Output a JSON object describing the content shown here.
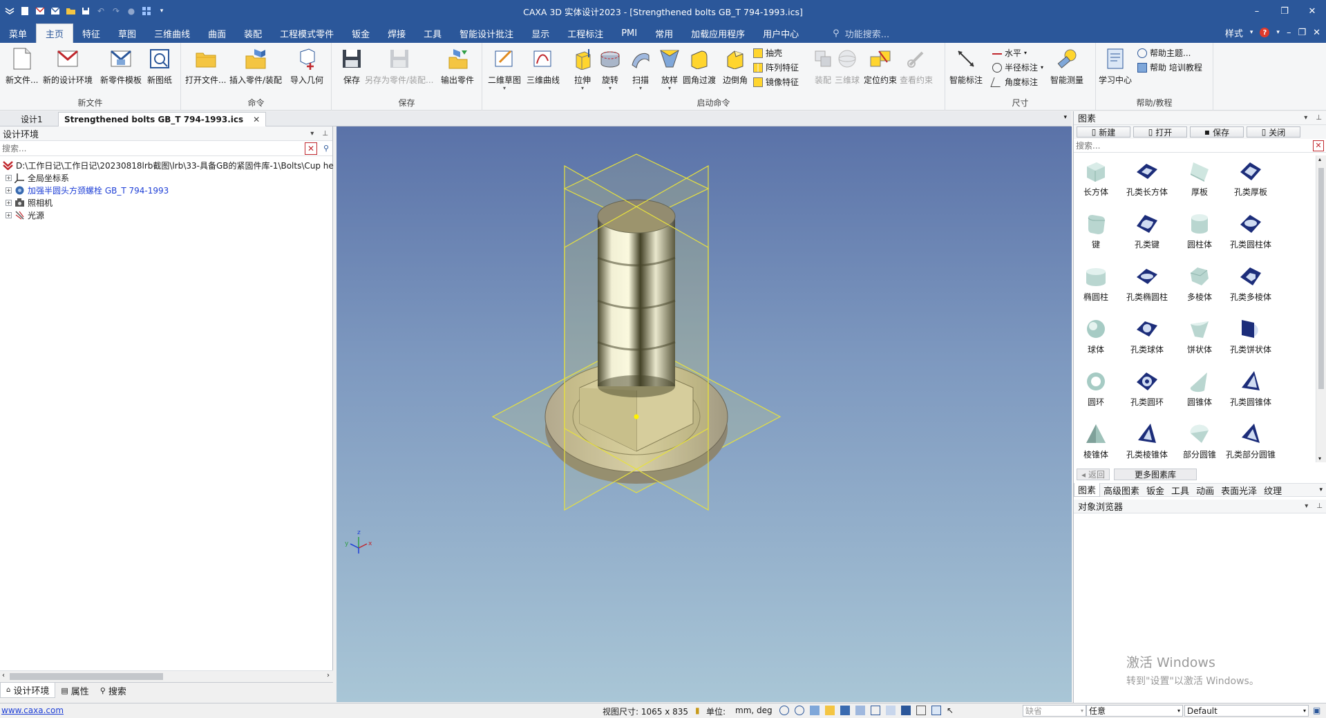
{
  "window": {
    "title": "CAXA 3D 实体设计2023 - [Strengthened bolts GB_T 794-1993.ics]",
    "controls": [
      "–",
      "❐",
      "✕"
    ]
  },
  "menu": {
    "tabs": [
      "菜单",
      "主页",
      "特征",
      "草图",
      "三维曲线",
      "曲面",
      "装配",
      "工程模式零件",
      "钣金",
      "焊接",
      "工具",
      "智能设计批注",
      "显示",
      "工程标注",
      "PMI",
      "常用",
      "加载应用程序",
      "用户中心"
    ],
    "active_index": 1,
    "search_placeholder": "功能搜索...",
    "style_label": "样式",
    "help_icon": "?"
  },
  "ribbon": {
    "groups": {
      "new_file": "新文件",
      "command": "命令",
      "save": "保存",
      "launch": "启动命令",
      "dimension": "尺寸",
      "help": "帮助/教程"
    },
    "buttons": {
      "new_file": "新文件...",
      "new_design_env": "新的设计环境",
      "new_part_template": "新零件模板",
      "new_drawing": "新图纸",
      "open_file": "打开文件...",
      "insert_part": "插入零件/装配",
      "import_geometry": "导入几何",
      "save": "保存",
      "save_as_part": "另存为零件/装配...",
      "export_part": "输出零件",
      "sketch_2d": "二维草图",
      "curve_3d": "三维曲线",
      "extrude": "拉伸",
      "revolve": "旋转",
      "sweep": "扫描",
      "loft": "放样",
      "fillet": "圆角过渡",
      "chamfer": "边倒角",
      "shell": "抽壳",
      "pattern": "阵列特征",
      "mirror": "镜像特征",
      "assembly": "装配",
      "ball_3d": "三维球",
      "position_constraint": "定位约束",
      "view_constraint": "查看约束",
      "smart_dimension": "智能标注",
      "horizontal": "水平",
      "radius_dim": "半径标注",
      "angle_dim": "角度标注",
      "smart_measure": "智能测量",
      "learning_center": "学习中心",
      "help_topics": "帮助主题...",
      "help_training": "帮助 培训教程"
    }
  },
  "doc_tabs": [
    {
      "label": "设计1",
      "active": false
    },
    {
      "label": "Strengthened bolts GB_T 794-1993.ics",
      "active": true
    }
  ],
  "left_panel": {
    "title": "设计环境",
    "search_placeholder": "搜索...",
    "tree": [
      {
        "label": "D:\\工作日记\\工作日记\\20230818lrb截图\\lrb\\33-具备GB的紧固件库-1\\Bolts\\Cup he",
        "icon": "design-env-icon",
        "link": false
      },
      {
        "label": "全局坐标系",
        "icon": "axis-icon",
        "link": false
      },
      {
        "label": "加强半圆头方颈螺栓 GB_T 794-1993",
        "icon": "part-icon",
        "link": true
      },
      {
        "label": "照相机",
        "icon": "camera-icon",
        "link": false
      },
      {
        "label": "光源",
        "icon": "light-icon",
        "link": false
      }
    ],
    "tabs": [
      "设计环境",
      "属性",
      "搜索"
    ]
  },
  "viewport": {
    "axis_labels": {
      "x": "x",
      "y": "y",
      "z": "z"
    }
  },
  "right_panel": {
    "title": "图素",
    "tools": [
      "新建",
      "打开",
      "保存",
      "关闭"
    ],
    "search_placeholder": "搜索...",
    "items": [
      [
        "长方体",
        "孔类长方体",
        "厚板",
        "孔类厚板"
      ],
      [
        "键",
        "孔类键",
        "圆柱体",
        "孔类圆柱体"
      ],
      [
        "椭圆柱",
        "孔类椭圆柱",
        "多棱体",
        "孔类多棱体"
      ],
      [
        "球体",
        "孔类球体",
        "饼状体",
        "孔类饼状体"
      ],
      [
        "圆环",
        "孔类圆环",
        "圆锥体",
        "孔类圆锥体"
      ],
      [
        "棱锥体",
        "孔类棱锥体",
        "部分圆锥",
        "孔类部分圆锥"
      ]
    ],
    "back_label": "返回",
    "more_label": "更多图素库",
    "tabs": [
      "图素",
      "高级图素",
      "钣金",
      "工具",
      "动画",
      "表面光泽",
      "纹理"
    ],
    "object_browser": "对象浏览器"
  },
  "watermark": {
    "line1": "激活 Windows",
    "line2": "转到\"设置\"以激活 Windows。"
  },
  "status": {
    "url": "www.caxa.com",
    "view_size": "视图尺寸: 1065 x  835",
    "unit_label": "单位:",
    "unit_value": "mm, deg",
    "combo1": "缺省",
    "combo2": "任意",
    "combo3": "Default"
  }
}
